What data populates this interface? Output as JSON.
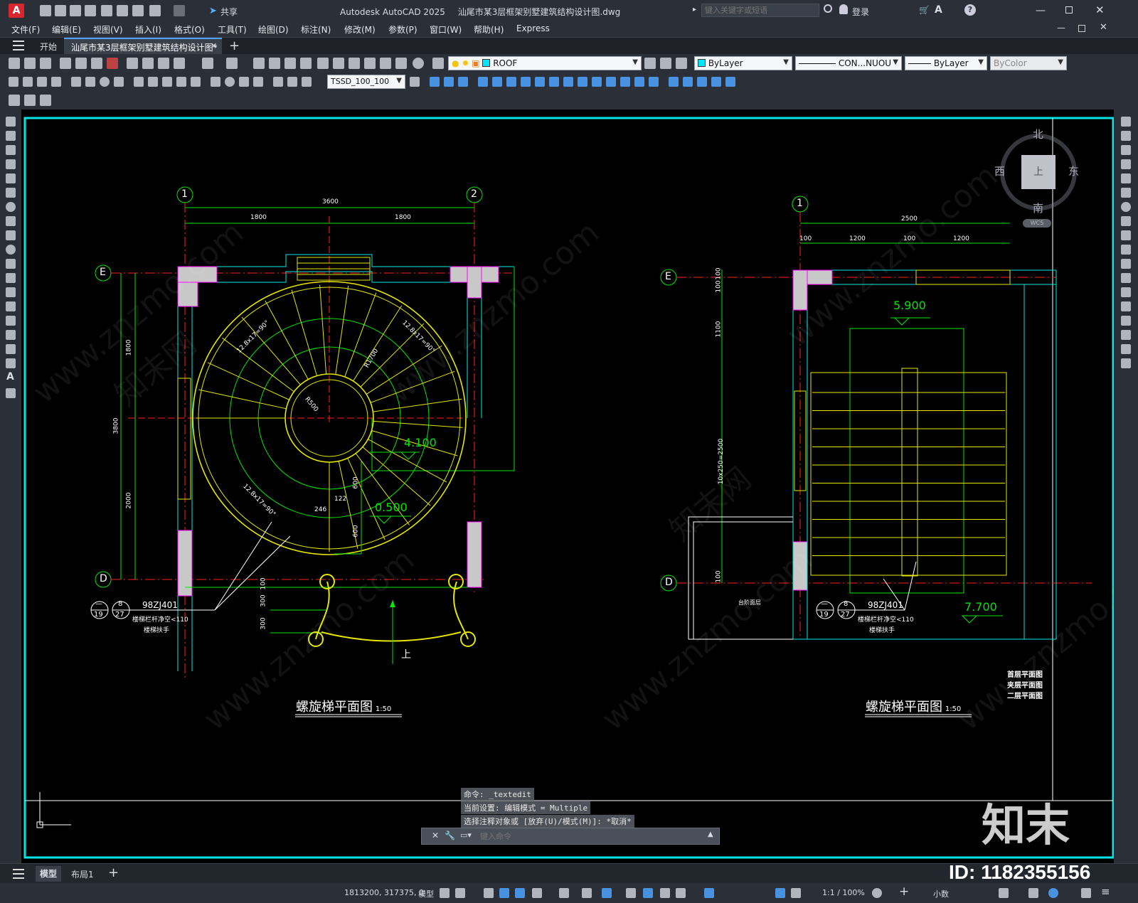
{
  "app": {
    "logo": "A",
    "title": "Autodesk AutoCAD 2025",
    "filename": "汕尾市某3层框架别墅建筑结构设计图.dwg",
    "share": "共享",
    "search_placeholder": "键入关键字或短语",
    "login": "登录"
  },
  "menu": [
    "文件(F)",
    "编辑(E)",
    "视图(V)",
    "插入(I)",
    "格式(O)",
    "工具(T)",
    "绘图(D)",
    "标注(N)",
    "修改(M)",
    "参数(P)",
    "窗口(W)",
    "帮助(H)",
    "Express"
  ],
  "tabs": {
    "start": "开始",
    "doc": "汕尾市某3层框架别墅建筑结构设计图*"
  },
  "toolbar": {
    "layer": "ROOF",
    "color": "ByLayer",
    "linetype": "CON...NUOU",
    "lineweight": "ByLayer",
    "plotstyle": "ByColor",
    "dimstyle": "TSSD_100_100"
  },
  "viewcube": {
    "north": "北",
    "south": "南",
    "east": "东",
    "west": "西",
    "top": "上",
    "wcs": "WCS"
  },
  "drawing": {
    "left": {
      "axis_1": "1",
      "axis_2": "2",
      "axis_E": "E",
      "axis_D": "D",
      "dim_total": "3600",
      "dim_a": "1800",
      "dim_b": "1800",
      "dim_v1": "1800",
      "dim_v2": "2000",
      "dim_vt": "3800",
      "dim_600a": "600",
      "dim_600b": "600",
      "dim_100": "100",
      "dim_300a": "300",
      "dim_300b": "300",
      "dim_122": "122",
      "dim_246": "246",
      "r500": "R500",
      "r1700": "R1700",
      "step1": "12.8x17=90°",
      "step2": "12.8x17=90°",
      "step3": "12.8x17=90°",
      "level_4100": "4.100",
      "level_0500": "0.500",
      "up": "上",
      "ref_top": "—",
      "ref_8": "8",
      "ref_19": "19",
      "ref_27": "27",
      "ref_code": "98ZJ401",
      "note1": "楼梯栏杆净空<110",
      "note2": "楼梯扶手",
      "title": "螺旋梯平面图",
      "scale": "1:50"
    },
    "right": {
      "axis_1": "1",
      "axis_E": "E",
      "axis_D": "D",
      "dim_total": "2500",
      "dim_a": "100",
      "dim_b": "1200",
      "dim_c": "100",
      "dim_d": "1200",
      "dim_v1": "100",
      "dim_v2": "100",
      "dim_v3": "1100",
      "dim_v4": "10x250=2500",
      "dim_v5": "100",
      "level_5900": "5.900",
      "level_7700": "7.700",
      "ref_top": "—",
      "ref_8": "8",
      "ref_19": "19",
      "ref_27": "27",
      "ref_code": "98ZJ401",
      "note1": "楼梯栏杆净空<110",
      "note2": "楼梯扶手",
      "side_note": "台阶面层",
      "legend": [
        "首层平面图",
        "夹层平面图",
        "二层平面图"
      ],
      "title": "螺旋梯平面图",
      "scale": "1:50"
    }
  },
  "command": {
    "line1": "命令: _textedit",
    "line2": "当前设置: 编辑模式 = Multiple",
    "line3": "选择注释对象或 [放弃(U)/模式(M)]: *取消*",
    "placeholder": "键入命令"
  },
  "layout_tabs": {
    "model": "模型",
    "layout1": "布局1"
  },
  "status": {
    "coords": "1813200, 317375, 0",
    "model": "模型",
    "scale": "1:1 / 100%",
    "units": "小数"
  },
  "watermark": {
    "brand": "知末",
    "id": "ID: 1182355156",
    "site": "www.znzmo.com",
    "site2": "知末网"
  },
  "colors": {
    "cad_yellow": "#e6e600",
    "cad_green": "#00e600",
    "cad_cyan": "#00e6e6",
    "cad_red": "#ff2020",
    "cad_magenta": "#ff00ff",
    "cad_white": "#ffffff",
    "accent": "#00e5ff"
  }
}
